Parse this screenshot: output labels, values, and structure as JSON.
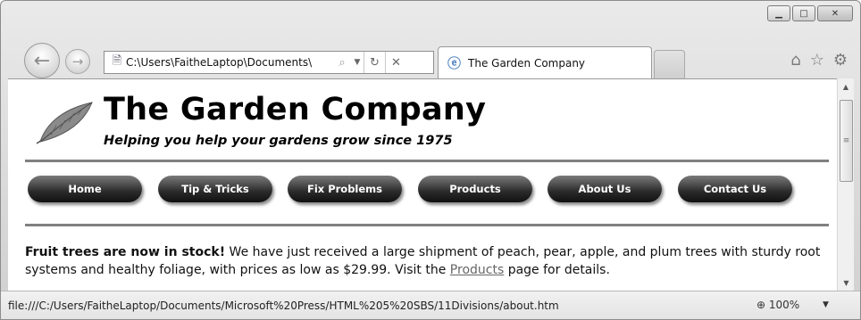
{
  "browser": {
    "address_url": "C:\\Users\\FaitheLaptop\\Documents\\",
    "tab_title": "The Garden Company",
    "caption_buttons": [
      "minimize",
      "maximize",
      "close"
    ],
    "zoom": "100%",
    "status_path": "file:///C:/Users/FaitheLaptop/Documents/Microsoft%20Press/HTML%205%20SBS/11Divisions/about.htm"
  },
  "page": {
    "site_title": "The Garden Company",
    "tagline": "Helping you help your gardens grow since 1975",
    "nav": [
      "Home",
      "Tip & Tricks",
      "Fix Problems",
      "Products",
      "About Us",
      "Contact Us"
    ],
    "para_bold": "Fruit trees are now in stock!",
    "para_text_1": " We have just received a large shipment of peach, pear, apple, and plum trees with sturdy root systems and healthy foliage, with prices as low as $29.99. Visit the ",
    "para_link": "Products",
    "para_text_2": " page for details."
  },
  "colors": {
    "rule": "#808080",
    "button_dark": "#111111",
    "link": "#666666"
  }
}
